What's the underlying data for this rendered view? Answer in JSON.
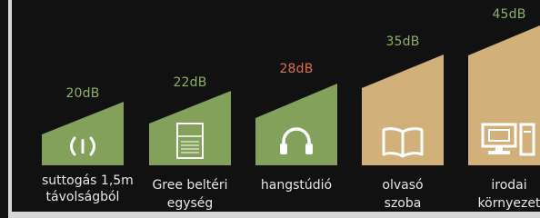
{
  "colors": {
    "green": "#83a15a",
    "tan": "#d2b07a",
    "label_green": "#8bb060",
    "label_orange": "#d9704a",
    "text": "#e6e6e6"
  },
  "levels": [
    {
      "db": "20dB",
      "caption_1": "suttogás 1,5m",
      "caption_2": "távolságból",
      "icon": "whisper-waves-icon",
      "color": "green"
    },
    {
      "db": "22dB",
      "caption_1": "Gree beltéri",
      "caption_2": "egység",
      "icon": "indoor-unit-icon",
      "color": "green"
    },
    {
      "db": "28dB",
      "caption_1": "hangstúdió",
      "caption_2": "",
      "icon": "headphones-icon",
      "color": "green"
    },
    {
      "db": "35dB",
      "caption_1": "olvasó",
      "caption_2": "szoba",
      "icon": "open-book-icon",
      "color": "tan"
    },
    {
      "db": "45dB",
      "caption_1": "irodai",
      "caption_2": "környezet",
      "icon": "office-computer-icon",
      "color": "tan"
    }
  ]
}
